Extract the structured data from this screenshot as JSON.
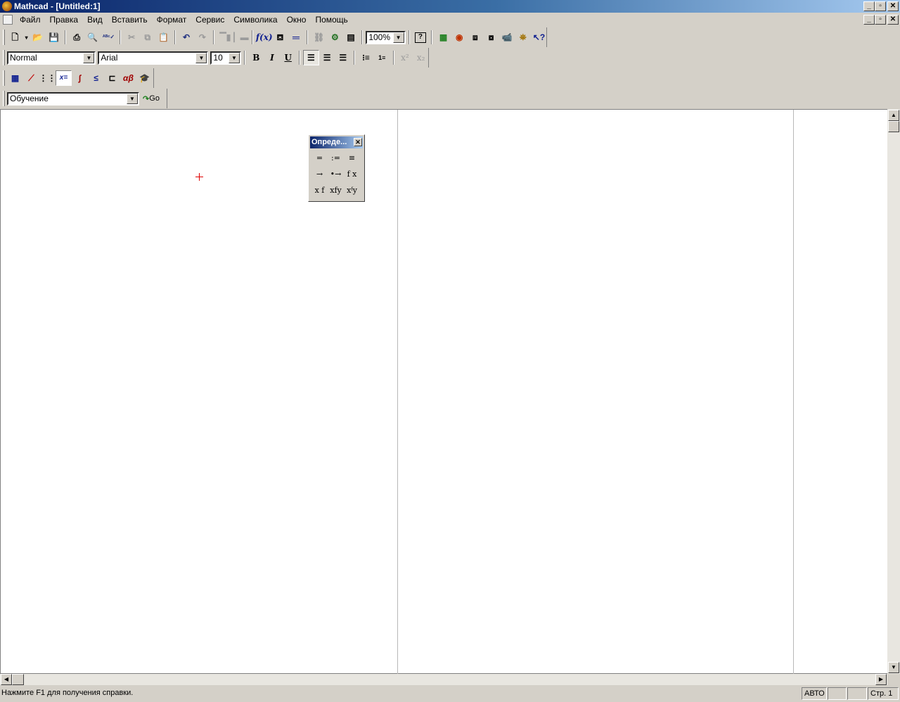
{
  "window": {
    "title": "Mathcad - [Untitled:1]",
    "controls": {
      "minimize": "_",
      "restore": "▫",
      "close": "✕"
    }
  },
  "menu": {
    "items": [
      "Файл",
      "Правка",
      "Вид",
      "Вставить",
      "Формат",
      "Сервис",
      "Символика",
      "Окно",
      "Помощь"
    ]
  },
  "standard_toolbar": {
    "zoom": "100%"
  },
  "formatting_toolbar": {
    "style": "Normal",
    "font": "Arial",
    "size": "10",
    "bold": "B",
    "italic": "I",
    "underline": "U"
  },
  "resources_toolbar": {
    "selected": "Обучение",
    "go_label": "Go"
  },
  "palette": {
    "title": "Опреде...",
    "buttons": [
      "=",
      ":=",
      "≡",
      "→",
      "•→",
      "f x",
      "x f",
      "xfy",
      "xᶠy"
    ]
  },
  "statusbar": {
    "help": "Нажмите F1 для получения справки.",
    "mode": "АВТО",
    "page": "Стр. 1"
  }
}
